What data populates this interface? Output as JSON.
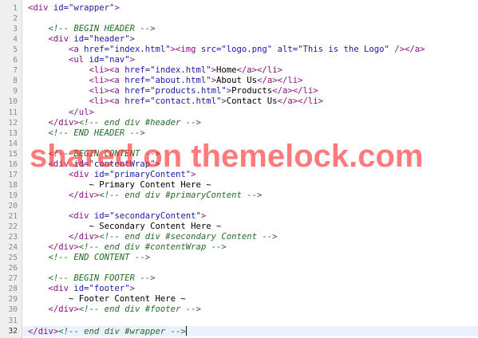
{
  "editor": {
    "current_line": 32,
    "lines": [
      {
        "n": "1",
        "tokens": [
          [
            "tag",
            "<div "
          ],
          [
            "attr",
            "id="
          ],
          [
            "val",
            "\"wrapper\""
          ],
          [
            "tag",
            ">"
          ]
        ]
      },
      {
        "n": "2",
        "tokens": []
      },
      {
        "n": "3",
        "tokens": [
          [
            "plain",
            "    "
          ],
          [
            "cmt",
            "<!-- BEGIN HEADER -->"
          ]
        ]
      },
      {
        "n": "4",
        "tokens": [
          [
            "plain",
            "    "
          ],
          [
            "tag",
            "<div "
          ],
          [
            "attr",
            "id="
          ],
          [
            "val",
            "\"header\""
          ],
          [
            "tag",
            ">"
          ]
        ]
      },
      {
        "n": "5",
        "tokens": [
          [
            "plain",
            "        "
          ],
          [
            "tag",
            "<a "
          ],
          [
            "attr",
            "href="
          ],
          [
            "val",
            "\"index.html\""
          ],
          [
            "tag",
            "><img "
          ],
          [
            "attr",
            "src="
          ],
          [
            "val",
            "\"logo.png\""
          ],
          [
            "plain",
            " "
          ],
          [
            "attr",
            "alt="
          ],
          [
            "val",
            "\"This is the Logo\""
          ],
          [
            "plain",
            " "
          ],
          [
            "tag",
            "/></a>"
          ]
        ]
      },
      {
        "n": "6",
        "tokens": [
          [
            "plain",
            "        "
          ],
          [
            "tag",
            "<ul "
          ],
          [
            "attr",
            "id="
          ],
          [
            "val",
            "\"nav\""
          ],
          [
            "tag",
            ">"
          ]
        ]
      },
      {
        "n": "7",
        "tokens": [
          [
            "plain",
            "            "
          ],
          [
            "tag",
            "<li><a "
          ],
          [
            "attr",
            "href="
          ],
          [
            "val",
            "\"index.html\""
          ],
          [
            "tag",
            ">"
          ],
          [
            "plain",
            "Home"
          ],
          [
            "tag",
            "</a></li>"
          ]
        ]
      },
      {
        "n": "8",
        "tokens": [
          [
            "plain",
            "            "
          ],
          [
            "tag",
            "<li><a "
          ],
          [
            "attr",
            "href="
          ],
          [
            "val",
            "\"about.html\""
          ],
          [
            "tag",
            ">"
          ],
          [
            "plain",
            "About Us"
          ],
          [
            "tag",
            "</a></li>"
          ]
        ]
      },
      {
        "n": "9",
        "tokens": [
          [
            "plain",
            "            "
          ],
          [
            "tag",
            "<li><a "
          ],
          [
            "attr",
            "href="
          ],
          [
            "val",
            "\"products.html\""
          ],
          [
            "tag",
            ">"
          ],
          [
            "plain",
            "Products"
          ],
          [
            "tag",
            "</a></li>"
          ]
        ]
      },
      {
        "n": "10",
        "tokens": [
          [
            "plain",
            "            "
          ],
          [
            "tag",
            "<li><a "
          ],
          [
            "attr",
            "href="
          ],
          [
            "val",
            "\"contact.html\""
          ],
          [
            "tag",
            ">"
          ],
          [
            "plain",
            "Contact Us"
          ],
          [
            "tag",
            "</a></li>"
          ]
        ]
      },
      {
        "n": "11",
        "tokens": [
          [
            "plain",
            "        "
          ],
          [
            "tag",
            "</ul>"
          ]
        ]
      },
      {
        "n": "12",
        "tokens": [
          [
            "plain",
            "    "
          ],
          [
            "tag",
            "</div>"
          ],
          [
            "cmt",
            "<!-- end div #header -->"
          ]
        ]
      },
      {
        "n": "13",
        "tokens": [
          [
            "plain",
            "    "
          ],
          [
            "cmt",
            "<!-- END HEADER -->"
          ]
        ]
      },
      {
        "n": "14",
        "tokens": []
      },
      {
        "n": "15",
        "tokens": [
          [
            "plain",
            "    "
          ],
          [
            "cmt",
            "<!-- BEGIN CONTENT -->"
          ]
        ]
      },
      {
        "n": "16",
        "tokens": [
          [
            "plain",
            "    "
          ],
          [
            "tag",
            "<div "
          ],
          [
            "attr",
            "id="
          ],
          [
            "val",
            "\"contentWrap\""
          ],
          [
            "tag",
            ">"
          ]
        ]
      },
      {
        "n": "17",
        "tokens": [
          [
            "plain",
            "        "
          ],
          [
            "tag",
            "<div "
          ],
          [
            "attr",
            "id="
          ],
          [
            "val",
            "\"primaryContent\""
          ],
          [
            "tag",
            ">"
          ]
        ]
      },
      {
        "n": "18",
        "tokens": [
          [
            "plain",
            "            ~ Primary Content Here ~"
          ]
        ]
      },
      {
        "n": "19",
        "tokens": [
          [
            "plain",
            "        "
          ],
          [
            "tag",
            "</div>"
          ],
          [
            "cmt",
            "<!-- end div #primaryContent -->"
          ]
        ]
      },
      {
        "n": "20",
        "tokens": []
      },
      {
        "n": "21",
        "tokens": [
          [
            "plain",
            "        "
          ],
          [
            "tag",
            "<div "
          ],
          [
            "attr",
            "id="
          ],
          [
            "val",
            "\"secondaryContent\""
          ],
          [
            "tag",
            ">"
          ]
        ]
      },
      {
        "n": "22",
        "tokens": [
          [
            "plain",
            "            ~ Secondary Content Here ~"
          ]
        ]
      },
      {
        "n": "23",
        "tokens": [
          [
            "plain",
            "        "
          ],
          [
            "tag",
            "</div>"
          ],
          [
            "cmt",
            "<!-- end div #secondary Content -->"
          ]
        ]
      },
      {
        "n": "24",
        "tokens": [
          [
            "plain",
            "    "
          ],
          [
            "tag",
            "</div>"
          ],
          [
            "cmt",
            "<!-- end div #contentWrap -->"
          ]
        ]
      },
      {
        "n": "25",
        "tokens": [
          [
            "plain",
            "    "
          ],
          [
            "cmt",
            "<!-- END CONTENT -->"
          ]
        ]
      },
      {
        "n": "26",
        "tokens": []
      },
      {
        "n": "27",
        "tokens": [
          [
            "plain",
            "    "
          ],
          [
            "cmt",
            "<!-- BEGIN FOOTER -->"
          ]
        ]
      },
      {
        "n": "28",
        "tokens": [
          [
            "plain",
            "    "
          ],
          [
            "tag",
            "<div "
          ],
          [
            "attr",
            "id="
          ],
          [
            "val",
            "\"footer\""
          ],
          [
            "tag",
            ">"
          ]
        ]
      },
      {
        "n": "29",
        "tokens": [
          [
            "plain",
            "        ~ Footer Content Here ~"
          ]
        ]
      },
      {
        "n": "30",
        "tokens": [
          [
            "plain",
            "    "
          ],
          [
            "tag",
            "</div>"
          ],
          [
            "cmt",
            "<!-- end div #footer -->"
          ]
        ]
      },
      {
        "n": "31",
        "tokens": []
      },
      {
        "n": "32",
        "tokens": [
          [
            "tag",
            "</div>"
          ],
          [
            "cmt",
            "<!-- end div #wrapper -->"
          ]
        ]
      }
    ]
  },
  "watermark": "shared on themelock.com",
  "colors": {
    "tag": "#881280",
    "attribute": "#1a1aa6",
    "comment": "#236e25",
    "watermark": "#ff2a2a",
    "gutter": "#efefef",
    "current_line": "#eaf1ff"
  }
}
